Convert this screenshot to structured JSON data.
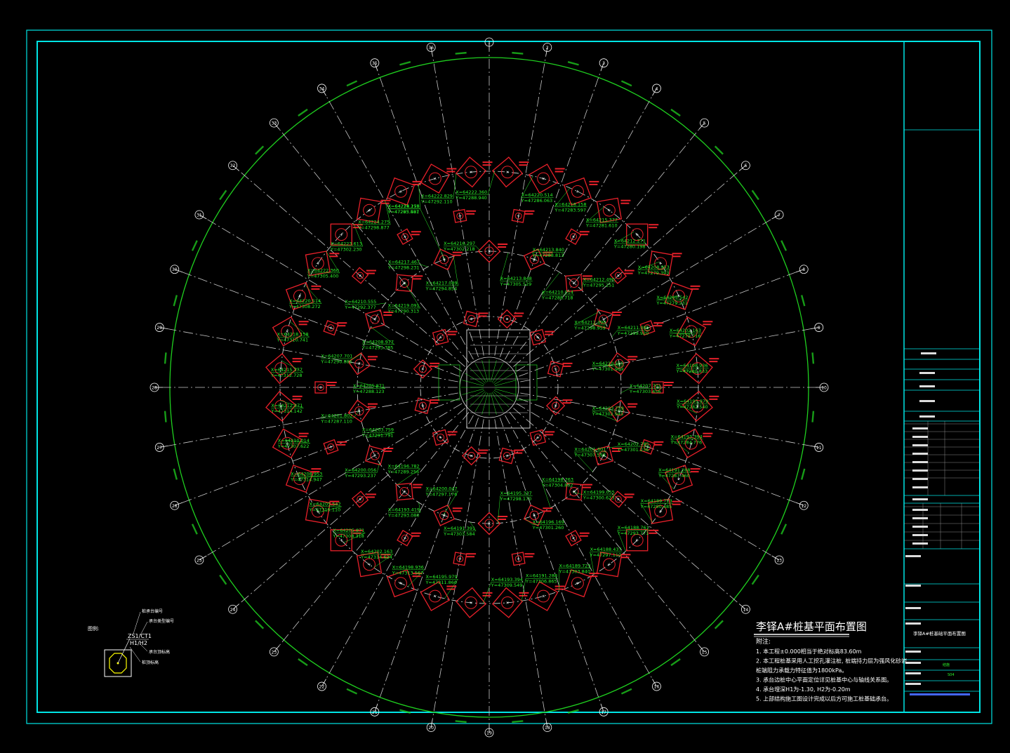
{
  "colors": {
    "background": "#000000",
    "frame": "#00e5e5",
    "grid_circle": "#1fd01f",
    "axis": "#c8c8c8",
    "pile": "#e8202a",
    "coord": "#2bf52b",
    "white": "#ffffff",
    "yellow": "#ffff00"
  },
  "drawing": {
    "title": "李铎A#桩基平面布置图",
    "notes_header": "附注:",
    "notes": [
      "1. 本工程±0.000相当于绝对标高83.60m",
      "2. 本工程桩基采用人工挖孔灌注桩, 桩端持力层为强风化砂岩,",
      "    桩端阻力承载力特征值为1800kPa。",
      "3. 承台边桩中心平面定位详见桩基中心与轴线关系图。",
      "4. 承台埋深H1为-1.30, H2为-0.20m",
      "5. 上部结构施工图设计完成以后方可施工桩基础承台。"
    ],
    "legend": {
      "label": "图例:",
      "zs": "ZS1/CT1",
      "h": "H1/H2",
      "callouts": [
        "桩承台编号",
        "承台类型编号",
        "承台顶标高",
        "桩顶标高"
      ]
    },
    "axis_labels_outer": [
      "1",
      "2",
      "3",
      "4",
      "5",
      "6",
      "7",
      "8",
      "9",
      "10",
      "11",
      "12",
      "13",
      "14",
      "15",
      "16",
      "17",
      "18",
      "19",
      "20",
      "21",
      "22",
      "23",
      "24",
      "25",
      "26",
      "27",
      "28",
      "29",
      "30",
      "31",
      "32",
      "33",
      "34",
      "35",
      "36"
    ],
    "coordinate_labels": [
      {
        "x": "X=64224.275",
        "y": "Y=47295.481"
      },
      {
        "x": "X=64222.829",
        "y": "Y=47292.110"
      },
      {
        "x": "X=64222.360",
        "y": "Y=47288.940"
      },
      {
        "x": "X=64220.514",
        "y": "Y=47286.063"
      },
      {
        "x": "X=64218.158",
        "y": "Y=47283.597"
      },
      {
        "x": "X=64215.377",
        "y": "Y=47281.610"
      },
      {
        "x": "X=64212.271",
        "y": "Y=47280.198"
      },
      {
        "x": "X=64208.953",
        "y": "Y=47279.393"
      },
      {
        "x": "X=64205.542",
        "y": "Y=47279.231"
      },
      {
        "x": "X=64202.163",
        "y": "Y=47279.716"
      },
      {
        "x": "X=64198.936",
        "y": "Y=47280.833"
      },
      {
        "x": "X=64195.979",
        "y": "Y=47282.540"
      },
      {
        "x": "X=64193.394",
        "y": "Y=47284.776"
      },
      {
        "x": "X=64191.288",
        "y": "Y=47287.460"
      },
      {
        "x": "X=64189.723",
        "y": "Y=47290.485"
      },
      {
        "x": "X=64188.761",
        "y": "Y=47293.771"
      },
      {
        "x": "X=64188.437",
        "y": "Y=47297.110"
      },
      {
        "x": "X=64189.723",
        "y": "Y=47303.840"
      },
      {
        "x": "X=64191.288",
        "y": "Y=47306.865"
      },
      {
        "x": "X=64193.394",
        "y": "Y=47309.549"
      },
      {
        "x": "X=64195.979",
        "y": "Y=47311.860"
      },
      {
        "x": "X=64198.936",
        "y": "Y=47313.567"
      },
      {
        "x": "X=64202.163",
        "y": "Y=47314.624"
      },
      {
        "x": "X=64205.871",
        "y": "Y=47308.318"
      },
      {
        "x": "X=64205.542",
        "y": "Y=47315.110"
      },
      {
        "x": "X=64208.953",
        "y": "Y=47314.947"
      },
      {
        "x": "X=64210.014",
        "y": "Y=47307.622"
      },
      {
        "x": "X=64212.271",
        "y": "Y=47314.142"
      },
      {
        "x": "X=64215.377",
        "y": "Y=47312.728"
      },
      {
        "x": "X=64218.158",
        "y": "Y=47310.741"
      },
      {
        "x": "X=64220.514",
        "y": "Y=47308.272"
      },
      {
        "x": "X=64222.360",
        "y": "Y=47305.400"
      },
      {
        "x": "X=64223.613",
        "y": "Y=47302.230"
      },
      {
        "x": "X=64224.275",
        "y": "Y=47298.877"
      },
      {
        "x": "X=64217.467",
        "y": "Y=47298.231"
      },
      {
        "x": "X=64217.089",
        "y": "Y=47294.854"
      },
      {
        "x": "X=64216.297",
        "y": "Y=47302.218"
      },
      {
        "x": "X=64213.848",
        "y": "Y=47305.529"
      },
      {
        "x": "X=64213.840",
        "y": "Y=47288.813"
      },
      {
        "x": "X=64210.014",
        "y": "Y=47288.718"
      },
      {
        "x": "X=64212.490",
        "y": "Y=47295.251"
      },
      {
        "x": "X=64212.490",
        "y": "Y=47298.959"
      },
      {
        "x": "X=64211.085",
        "y": "Y=47299.920"
      },
      {
        "x": "X=64210.555",
        "y": "Y=47301.969"
      },
      {
        "x": "X=64207.701",
        "y": "Y=47303.456"
      },
      {
        "x": "X=64203.759",
        "y": "Y=47302.945"
      },
      {
        "x": "X=64202.785",
        "y": "Y=47301.236"
      },
      {
        "x": "X=64201.601",
        "y": "Y=47307.593"
      },
      {
        "x": "X=64199.055",
        "y": "Y=47300.623"
      },
      {
        "x": "X=64198.763",
        "y": "Y=47304.802"
      },
      {
        "x": "X=64196.169",
        "y": "Y=47301.260"
      },
      {
        "x": "X=64195.337",
        "y": "Y=47298.170"
      },
      {
        "x": "X=64191.391",
        "y": "Y=47303.584"
      },
      {
        "x": "X=64200.047",
        "y": "Y=47297.176"
      },
      {
        "x": "X=64193.419",
        "y": "Y=47293.080"
      },
      {
        "x": "X=64196.782",
        "y": "Y=47289.256"
      },
      {
        "x": "X=64200.056",
        "y": "Y=47293.237"
      },
      {
        "x": "X=64203.759",
        "y": "Y=47291.791"
      },
      {
        "x": "X=64201.802",
        "y": "Y=47287.110"
      },
      {
        "x": "X=64205.871",
        "y": "Y=47288.123"
      },
      {
        "x": "X=64207.701",
        "y": "Y=47290.885"
      },
      {
        "x": "X=64208.977",
        "y": "Y=47293.385"
      },
      {
        "x": "X=64210.555",
        "y": "Y=47292.377"
      },
      {
        "x": "X=64219.091",
        "y": "Y=47290.313"
      },
      {
        "x": "X=64218.158",
        "y": "Y=47283.597"
      }
    ],
    "title_block": {
      "project": "李铎A#桩基础平面布置图",
      "drawing_no": "结施",
      "sheet": "S04"
    }
  }
}
